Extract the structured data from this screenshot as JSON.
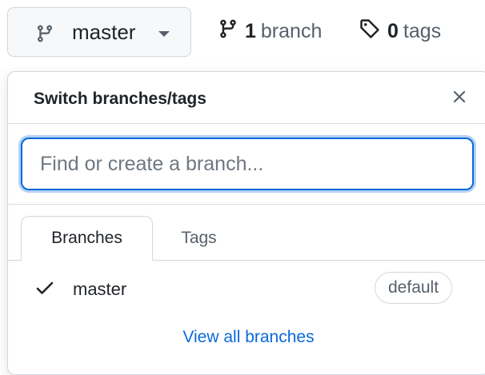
{
  "branch_button": {
    "label": "master",
    "icon": "git-branch-icon",
    "caret": "caret-down-icon"
  },
  "stats": {
    "branches": {
      "count": "1",
      "label": "branch",
      "icon": "git-branch-icon"
    },
    "tags": {
      "count": "0",
      "label": "tags",
      "icon": "tag-icon"
    }
  },
  "panel": {
    "title": "Switch branches/tags",
    "close_icon": "close-icon",
    "filter": {
      "placeholder": "Find or create a branch...",
      "value": ""
    },
    "tabs": [
      {
        "label": "Branches",
        "selected": true
      },
      {
        "label": "Tags",
        "selected": false
      }
    ],
    "branches": [
      {
        "name": "master",
        "checked": true,
        "badge": "default"
      }
    ],
    "footer_link": "View all branches"
  },
  "colors": {
    "accent": "#0969da",
    "border": "#d0d7de",
    "muted": "#57606a",
    "text": "#1f2328"
  }
}
